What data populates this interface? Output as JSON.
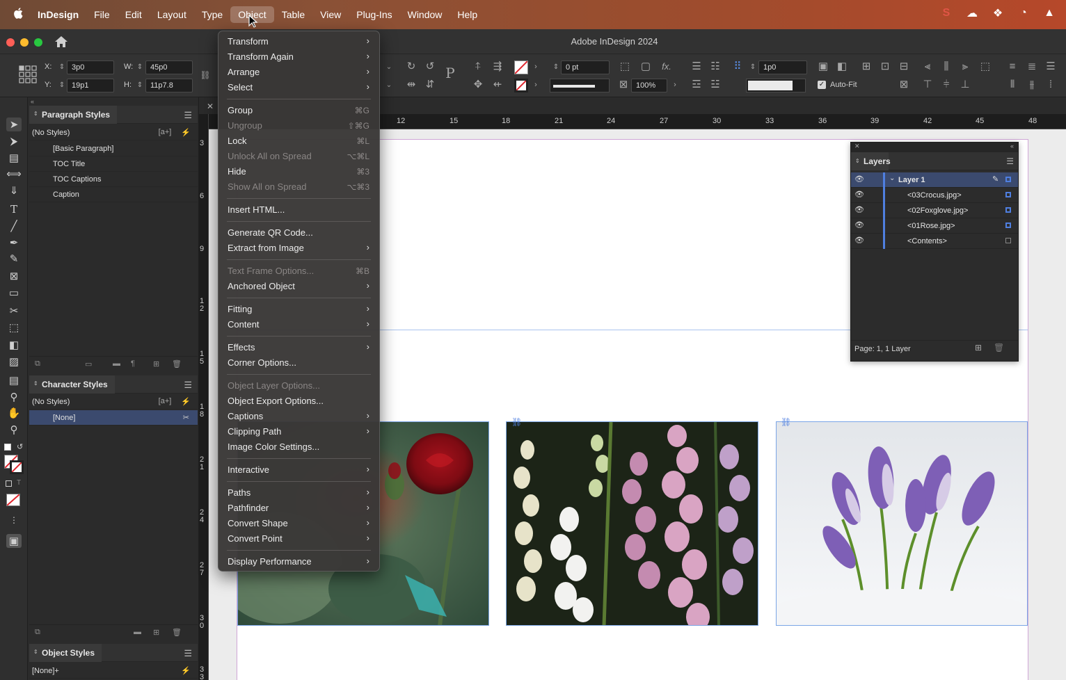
{
  "menubar": {
    "app": "InDesign",
    "items": [
      "File",
      "Edit",
      "Layout",
      "Type",
      "Object",
      "Table",
      "View",
      "Plug-Ins",
      "Window",
      "Help"
    ],
    "active": "Object"
  },
  "window": {
    "title": "Adobe InDesign 2024"
  },
  "control": {
    "x": "3p0",
    "y": "19p1",
    "w": "45p0",
    "h": "11p7.8",
    "x_label": "X:",
    "y_label": "Y:",
    "w_label": "W:",
    "h_label": "H:",
    "stroke_weight": "0 pt",
    "scale": "100%",
    "gap": "1p0",
    "autofit": "Auto-Fit"
  },
  "paragraph_styles": {
    "title": "Paragraph Styles",
    "none": "(No Styles)",
    "items": [
      "[Basic Paragraph]",
      "TOC Title",
      "TOC Captions",
      "Caption"
    ]
  },
  "character_styles": {
    "title": "Character Styles",
    "none": "(No Styles)",
    "selected": "[None]"
  },
  "object_styles": {
    "title": "Object Styles",
    "current": "[None]+"
  },
  "ruler": {
    "h": [
      "12",
      "15",
      "18",
      "21",
      "24",
      "27",
      "30",
      "33",
      "36",
      "39",
      "42",
      "45",
      "48"
    ],
    "v": [
      "3",
      "6",
      "9",
      "12",
      "15",
      "18",
      "21",
      "24",
      "27",
      "30",
      "33"
    ]
  },
  "layers": {
    "title": "Layers",
    "layer": "Layer 1",
    "items": [
      "<03Crocus.jpg>",
      "<02Foxglove.jpg>",
      "<01Rose.jpg>",
      "<Contents>"
    ],
    "footer": "Page: 1, 1 Layer"
  },
  "object_menu": {
    "groups": [
      [
        {
          "label": "Transform",
          "sub": true
        },
        {
          "label": "Transform Again",
          "sub": true
        },
        {
          "label": "Arrange",
          "sub": true
        },
        {
          "label": "Select",
          "sub": true
        }
      ],
      [
        {
          "label": "Group",
          "shortcut": "⌘G"
        },
        {
          "label": "Ungroup",
          "shortcut": "⇧⌘G",
          "disabled": true
        },
        {
          "label": "Lock",
          "shortcut": "⌘L"
        },
        {
          "label": "Unlock All on Spread",
          "shortcut": "⌥⌘L",
          "disabled": true
        },
        {
          "label": "Hide",
          "shortcut": "⌘3"
        },
        {
          "label": "Show All on Spread",
          "shortcut": "⌥⌘3",
          "disabled": true
        }
      ],
      [
        {
          "label": "Insert HTML..."
        }
      ],
      [
        {
          "label": "Generate QR Code..."
        },
        {
          "label": "Extract from Image",
          "sub": true
        }
      ],
      [
        {
          "label": "Text Frame Options...",
          "shortcut": "⌘B",
          "disabled": true
        },
        {
          "label": "Anchored Object",
          "sub": true
        }
      ],
      [
        {
          "label": "Fitting",
          "sub": true
        },
        {
          "label": "Content",
          "sub": true
        }
      ],
      [
        {
          "label": "Effects",
          "sub": true
        },
        {
          "label": "Corner Options..."
        }
      ],
      [
        {
          "label": "Object Layer Options...",
          "disabled": true
        },
        {
          "label": "Object Export Options..."
        },
        {
          "label": "Captions",
          "sub": true
        },
        {
          "label": "Clipping Path",
          "sub": true
        },
        {
          "label": "Image Color Settings..."
        }
      ],
      [
        {
          "label": "Interactive",
          "sub": true
        }
      ],
      [
        {
          "label": "Paths",
          "sub": true
        },
        {
          "label": "Pathfinder",
          "sub": true
        },
        {
          "label": "Convert Shape",
          "sub": true
        },
        {
          "label": "Convert Point",
          "sub": true
        }
      ],
      [
        {
          "label": "Display Performance",
          "sub": true
        }
      ]
    ]
  },
  "colors": {
    "selection_blue": "#3b4a6e",
    "layer_color": "#4f7fe0"
  }
}
